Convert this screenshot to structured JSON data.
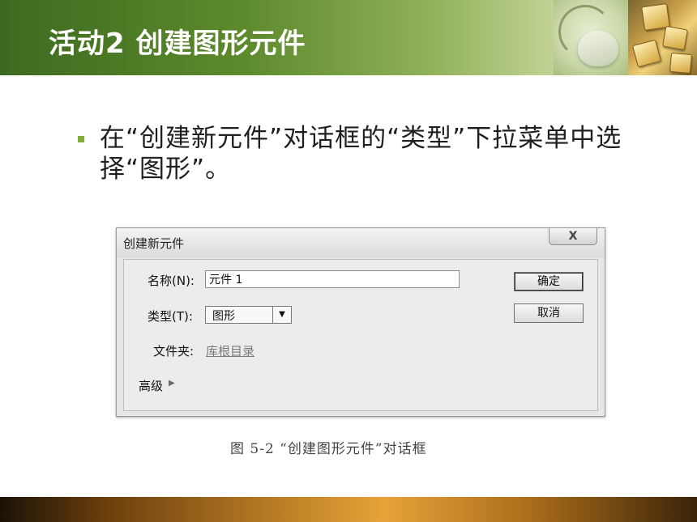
{
  "slide": {
    "title": "活动2  创建图形元件",
    "bullet": "在“创建新元件”对话框的“类型”下拉菜单中选择“图形”。",
    "caption": "图 5-2  “创建图形元件”对话框"
  },
  "dialog": {
    "title": "创建新元件",
    "close_label": "X",
    "name_label": "名称(N):",
    "name_value": "元件 1",
    "type_label": "类型(T):",
    "type_value": "图形",
    "type_arrow": "▼",
    "folder_label": "文件夹:",
    "folder_value": "库根目录",
    "advanced_label": "高级",
    "advanced_arrow": "▶",
    "ok_label": "确定",
    "cancel_label": "取消"
  },
  "colors": {
    "header_green": "#5d8a2c",
    "bullet_green": "#7fae3b",
    "footer_orange": "#e6a33a"
  },
  "icons": [
    "mouse-photo",
    "keyboard-keys-photo",
    "close-icon",
    "dropdown-arrow-icon",
    "expand-arrow-icon"
  ]
}
